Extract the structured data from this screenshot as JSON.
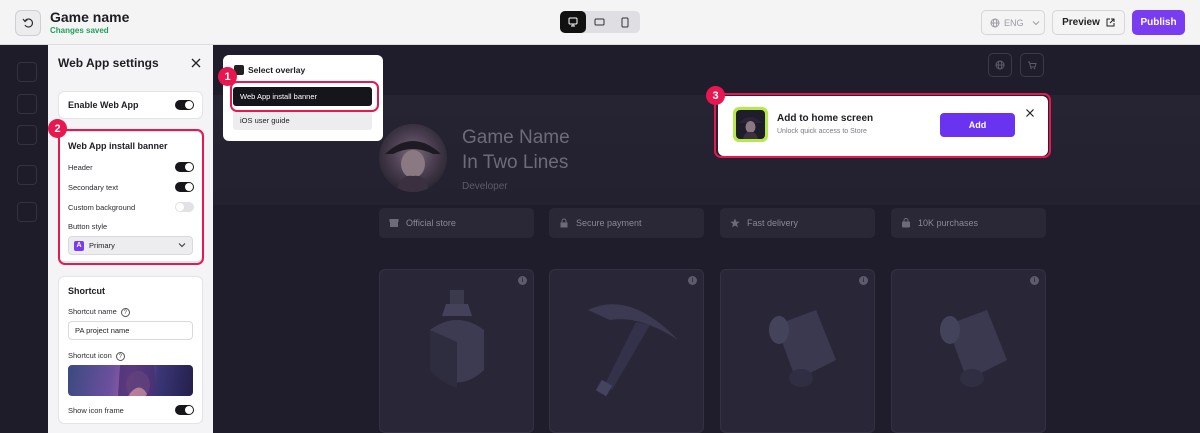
{
  "header": {
    "game_title": "Game name",
    "save_status": "Changes saved",
    "language": "ENG",
    "preview_label": "Preview",
    "publish_label": "Publish"
  },
  "settings": {
    "title": "Web App settings",
    "enable_label": "Enable Web App",
    "install_banner": {
      "title": "Web App install banner",
      "header_label": "Header",
      "secondary_label": "Secondary text",
      "custom_bg_label": "Custom background",
      "button_style_label": "Button style",
      "button_style_value": "Primary",
      "button_style_badge": "A"
    },
    "shortcut": {
      "title": "Shortcut",
      "name_label": "Shortcut name",
      "name_value": "PA project name",
      "icon_label": "Shortcut icon",
      "frame_label": "Show icon frame"
    }
  },
  "overlay": {
    "title": "Select overlay",
    "options": [
      "Web App install banner",
      "iOS user guide"
    ]
  },
  "markers": [
    "1",
    "2",
    "3"
  ],
  "store": {
    "game_name_line1": "Game Name",
    "game_name_line2": "In Two Lines",
    "developer": "Developer",
    "features": [
      "Official store",
      "Secure payment",
      "Fast delivery",
      "10K purchases"
    ]
  },
  "banner": {
    "title": "Add to home screen",
    "subtitle": "Unlock quick access to Store",
    "add_label": "Add"
  },
  "colors": {
    "accent": "#7a3cf0",
    "highlight": "#e8174f",
    "saved_green": "#1fa05a",
    "store_bg": "#1f1d2b"
  }
}
